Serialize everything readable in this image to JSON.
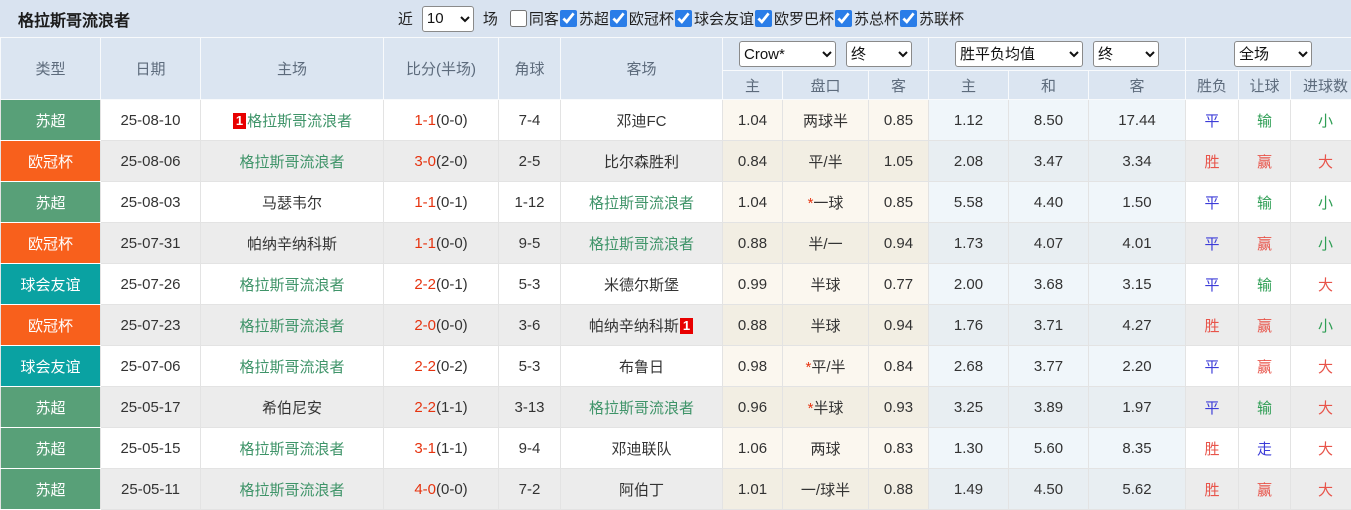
{
  "topbar": {
    "title": "格拉斯哥流浪者",
    "recent_label": "近",
    "recent_value": "10",
    "unit_label": "场",
    "filters": [
      {
        "label": "同客",
        "checked": false
      },
      {
        "label": "苏超",
        "checked": true
      },
      {
        "label": "欧冠杯",
        "checked": true
      },
      {
        "label": "球会友谊",
        "checked": true
      },
      {
        "label": "欧罗巴杯",
        "checked": true
      },
      {
        "label": "苏总杯",
        "checked": true
      },
      {
        "label": "苏联杯",
        "checked": true
      }
    ]
  },
  "table": {
    "main_headers": {
      "type": "类型",
      "date": "日期",
      "home": "主场",
      "score": "比分(半场)",
      "corner": "角球",
      "away": "客场"
    },
    "selects": {
      "company": "Crow*",
      "final1": "终",
      "avg": "胜平负均值",
      "final2": "终",
      "scope": "全场"
    },
    "sub_headers": {
      "odds_home": "主",
      "handicap": "盘口",
      "odds_away": "客",
      "avg_home": "主",
      "avg_draw": "和",
      "avg_away": "客",
      "result": "胜负",
      "let": "让球",
      "goals": "进球数"
    },
    "rows": [
      {
        "type": "苏超",
        "type_class": "green",
        "date": "25-08-10",
        "home_badge": "1",
        "home": "格拉斯哥流浪者",
        "home_focus": true,
        "score": "1-1",
        "half": "(0-0)",
        "corner": "7-4",
        "away": "邓迪FC",
        "away_badge": "",
        "away_focus": false,
        "odds_home": "1.04",
        "handicap_star": "",
        "handicap": "两球半",
        "odds_away": "0.85",
        "avg_home": "1.12",
        "avg_draw": "8.50",
        "avg_away": "17.44",
        "result": "平",
        "result_class": "blue",
        "let": "输",
        "let_class": "green",
        "goals": "小",
        "goals_class": "green"
      },
      {
        "type": "欧冠杯",
        "type_class": "orange",
        "date": "25-08-06",
        "home_badge": "",
        "home": "格拉斯哥流浪者",
        "home_focus": true,
        "score": "3-0",
        "half": "(2-0)",
        "corner": "2-5",
        "away": "比尔森胜利",
        "away_badge": "",
        "away_focus": false,
        "odds_home": "0.84",
        "handicap_star": "",
        "handicap": "平/半",
        "odds_away": "1.05",
        "avg_home": "2.08",
        "avg_draw": "3.47",
        "avg_away": "3.34",
        "result": "胜",
        "result_class": "red",
        "let": "赢",
        "let_class": "red",
        "goals": "大",
        "goals_class": "red"
      },
      {
        "type": "苏超",
        "type_class": "green",
        "date": "25-08-03",
        "home_badge": "",
        "home": "马瑟韦尔",
        "home_focus": false,
        "score": "1-1",
        "half": "(0-1)",
        "corner": "1-12",
        "away": "格拉斯哥流浪者",
        "away_badge": "",
        "away_focus": true,
        "odds_home": "1.04",
        "handicap_star": "*",
        "handicap": "一球",
        "odds_away": "0.85",
        "avg_home": "5.58",
        "avg_draw": "4.40",
        "avg_away": "1.50",
        "result": "平",
        "result_class": "blue",
        "let": "输",
        "let_class": "green",
        "goals": "小",
        "goals_class": "green"
      },
      {
        "type": "欧冠杯",
        "type_class": "orange",
        "date": "25-07-31",
        "home_badge": "",
        "home": "帕纳辛纳科斯",
        "home_focus": false,
        "score": "1-1",
        "half": "(0-0)",
        "corner": "9-5",
        "away": "格拉斯哥流浪者",
        "away_badge": "",
        "away_focus": true,
        "odds_home": "0.88",
        "handicap_star": "",
        "handicap": "半/一",
        "odds_away": "0.94",
        "avg_home": "1.73",
        "avg_draw": "4.07",
        "avg_away": "4.01",
        "result": "平",
        "result_class": "blue",
        "let": "赢",
        "let_class": "red",
        "goals": "小",
        "goals_class": "green"
      },
      {
        "type": "球会友谊",
        "type_class": "teal",
        "date": "25-07-26",
        "home_badge": "",
        "home": "格拉斯哥流浪者",
        "home_focus": true,
        "score": "2-2",
        "half": "(0-1)",
        "corner": "5-3",
        "away": "米德尔斯堡",
        "away_badge": "",
        "away_focus": false,
        "odds_home": "0.99",
        "handicap_star": "",
        "handicap": "半球",
        "odds_away": "0.77",
        "avg_home": "2.00",
        "avg_draw": "3.68",
        "avg_away": "3.15",
        "result": "平",
        "result_class": "blue",
        "let": "输",
        "let_class": "green",
        "goals": "大",
        "goals_class": "red"
      },
      {
        "type": "欧冠杯",
        "type_class": "orange",
        "date": "25-07-23",
        "home_badge": "",
        "home": "格拉斯哥流浪者",
        "home_focus": true,
        "score": "2-0",
        "half": "(0-0)",
        "corner": "3-6",
        "away": "帕纳辛纳科斯",
        "away_badge": "1",
        "away_focus": false,
        "odds_home": "0.88",
        "handicap_star": "",
        "handicap": "半球",
        "odds_away": "0.94",
        "avg_home": "1.76",
        "avg_draw": "3.71",
        "avg_away": "4.27",
        "result": "胜",
        "result_class": "red",
        "let": "赢",
        "let_class": "red",
        "goals": "小",
        "goals_class": "green"
      },
      {
        "type": "球会友谊",
        "type_class": "teal",
        "date": "25-07-06",
        "home_badge": "",
        "home": "格拉斯哥流浪者",
        "home_focus": true,
        "score": "2-2",
        "half": "(0-2)",
        "corner": "5-3",
        "away": "布鲁日",
        "away_badge": "",
        "away_focus": false,
        "odds_home": "0.98",
        "handicap_star": "*",
        "handicap": "平/半",
        "odds_away": "0.84",
        "avg_home": "2.68",
        "avg_draw": "3.77",
        "avg_away": "2.20",
        "result": "平",
        "result_class": "blue",
        "let": "赢",
        "let_class": "red",
        "goals": "大",
        "goals_class": "red"
      },
      {
        "type": "苏超",
        "type_class": "green",
        "date": "25-05-17",
        "home_badge": "",
        "home": "希伯尼安",
        "home_focus": false,
        "score": "2-2",
        "half": "(1-1)",
        "corner": "3-13",
        "away": "格拉斯哥流浪者",
        "away_badge": "",
        "away_focus": true,
        "odds_home": "0.96",
        "handicap_star": "*",
        "handicap": "半球",
        "odds_away": "0.93",
        "avg_home": "3.25",
        "avg_draw": "3.89",
        "avg_away": "1.97",
        "result": "平",
        "result_class": "blue",
        "let": "输",
        "let_class": "green",
        "goals": "大",
        "goals_class": "red"
      },
      {
        "type": "苏超",
        "type_class": "green",
        "date": "25-05-15",
        "home_badge": "",
        "home": "格拉斯哥流浪者",
        "home_focus": true,
        "score": "3-1",
        "half": "(1-1)",
        "corner": "9-4",
        "away": "邓迪联队",
        "away_badge": "",
        "away_focus": false,
        "odds_home": "1.06",
        "handicap_star": "",
        "handicap": "两球",
        "odds_away": "0.83",
        "avg_home": "1.30",
        "avg_draw": "5.60",
        "avg_away": "8.35",
        "result": "胜",
        "result_class": "red",
        "let": "走",
        "let_class": "blue",
        "goals": "大",
        "goals_class": "red"
      },
      {
        "type": "苏超",
        "type_class": "green",
        "date": "25-05-11",
        "home_badge": "",
        "home": "格拉斯哥流浪者",
        "home_focus": true,
        "score": "4-0",
        "half": "(0-0)",
        "corner": "7-2",
        "away": "阿伯丁",
        "away_badge": "",
        "away_focus": false,
        "odds_home": "1.01",
        "handicap_star": "",
        "handicap": "一/球半",
        "odds_away": "0.88",
        "avg_home": "1.49",
        "avg_draw": "4.50",
        "avg_away": "5.62",
        "result": "胜",
        "result_class": "red",
        "let": "赢",
        "let_class": "red",
        "goals": "大",
        "goals_class": "red"
      }
    ]
  },
  "colors": {
    "league_green": "#58a078",
    "league_orange": "#f8601c",
    "league_teal": "#0aa2a2",
    "focus_team_green": "#3f9469",
    "score_red": "#e6330f",
    "win_red": "#e8544a",
    "draw_blue": "#3c3cd8",
    "lose_green": "#2f9e55",
    "header_bg": "#dbe5f1",
    "stripe_gray": "#ececec",
    "handicap_cream": "#fbf7ef",
    "avg_pale_blue": "#f0f6fa"
  }
}
